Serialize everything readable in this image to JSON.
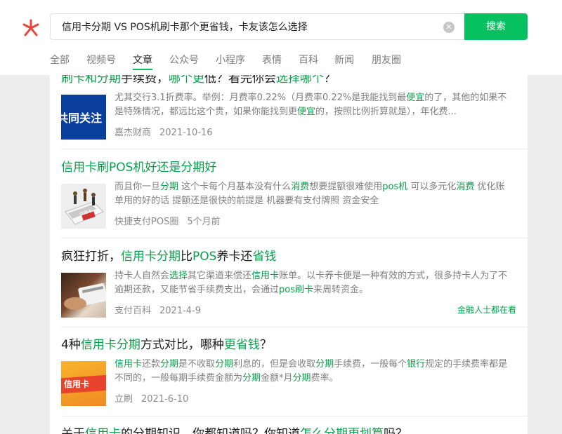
{
  "search": {
    "query": "信用卡分期 VS POS机刷卡那个更省钱，卡友该怎么选择",
    "button": "搜索"
  },
  "tabs": [
    "全部",
    "视频号",
    "文章",
    "公众号",
    "小程序",
    "表情",
    "百科",
    "新闻",
    "朋友圈"
  ],
  "active_tab": "文章",
  "results": [
    {
      "title": [
        {
          "t": "刷卡和分期",
          "h": true
        },
        {
          "t": "手续费，",
          "h": false
        },
        {
          "t": "哪个更",
          "h": true
        },
        {
          "t": "低？看完你会",
          "h": false
        },
        {
          "t": "选择哪个",
          "h": true
        },
        {
          "t": "？",
          "h": false
        }
      ],
      "thumb_text": "共同关注",
      "desc": [
        {
          "t": "尤其交行3.1折费率。举例：月费率0.22%（月费率0.22%是我能找到最",
          "h": false
        },
        {
          "t": "便宜",
          "h": true
        },
        {
          "t": "的了，其他的如果不是特殊情况，都远比这个贵，如果你能找到更",
          "h": false
        },
        {
          "t": "便宜",
          "h": true
        },
        {
          "t": "的，按照比例折算就是），年化费...",
          "h": false
        }
      ],
      "source": "嘉杰财商",
      "date": "2021-10-16"
    },
    {
      "title": [
        {
          "t": "信用卡刷POS机好还是分期好",
          "h": true
        }
      ],
      "thumb_text": "信用卡",
      "desc": [
        {
          "t": "而且你一旦",
          "h": false
        },
        {
          "t": "分期",
          "h": true
        },
        {
          "t": " 这个卡每个月基本没有什么",
          "h": false
        },
        {
          "t": "消费",
          "h": true
        },
        {
          "t": "想要提额很难使用",
          "h": false
        },
        {
          "t": "pos机",
          "h": true
        },
        {
          "t": " 可以多元化",
          "h": false
        },
        {
          "t": "消费",
          "h": true
        },
        {
          "t": " 优化账单用的好的话 提额还是很快的前提是 机器要有支付牌照 资金安全",
          "h": false
        }
      ],
      "source": "快捷支付POS圈",
      "date": "5个月前"
    },
    {
      "title": [
        {
          "t": "疯狂打折，",
          "h": false
        },
        {
          "t": "信用卡分期",
          "h": true
        },
        {
          "t": "比",
          "h": false
        },
        {
          "t": "POS",
          "h": true
        },
        {
          "t": "养卡还",
          "h": false
        },
        {
          "t": "省钱",
          "h": true
        }
      ],
      "desc": [
        {
          "t": "持卡人自然会",
          "h": false
        },
        {
          "t": "选择",
          "h": true
        },
        {
          "t": "其它渠道来偿还",
          "h": false
        },
        {
          "t": "信用卡",
          "h": true
        },
        {
          "t": "账单。以卡养卡便是一种有效的方式，很多持卡人为了不逾期还款，又能节省手续费支出，会通过",
          "h": false
        },
        {
          "t": "pos刷卡",
          "h": true
        },
        {
          "t": "来周转资金。",
          "h": false
        }
      ],
      "source": "支付百科",
      "date": "2021-4-9",
      "extra": "金融人士都在看"
    },
    {
      "title": [
        {
          "t": "4种",
          "h": false
        },
        {
          "t": "信用卡分期",
          "h": true
        },
        {
          "t": "方式对比，哪种",
          "h": false
        },
        {
          "t": "更省钱",
          "h": true
        },
        {
          "t": "？",
          "h": false
        }
      ],
      "thumb_text": "信用卡",
      "desc": [
        {
          "t": "信用卡",
          "h": true
        },
        {
          "t": "还款",
          "h": false
        },
        {
          "t": "分期",
          "h": true
        },
        {
          "t": "是不收取",
          "h": false
        },
        {
          "t": "分期",
          "h": true
        },
        {
          "t": "利息的，但是会收取",
          "h": false
        },
        {
          "t": "分期",
          "h": true
        },
        {
          "t": "手续费，一般每个",
          "h": false
        },
        {
          "t": "银行",
          "h": true
        },
        {
          "t": "规定的手续费率都是不同的，一般每期手续费金额为",
          "h": false
        },
        {
          "t": "分期",
          "h": true
        },
        {
          "t": "金额*月",
          "h": false
        },
        {
          "t": "分期",
          "h": true
        },
        {
          "t": "费率。",
          "h": false
        }
      ],
      "source": "立刷",
      "date": "2021-6-10"
    },
    {
      "title": [
        {
          "t": "关于",
          "h": false
        },
        {
          "t": "信用卡",
          "h": true
        },
        {
          "t": "的分期知识，你都知道吗？你知道",
          "h": false
        },
        {
          "t": "怎么分期更划算",
          "h": true
        },
        {
          "t": "吗？",
          "h": false
        }
      ]
    }
  ],
  "colors": {
    "accent": "#07c160",
    "highlight": "#07a04b",
    "background": "#ededed"
  },
  "icons": {
    "logo": "wechat-search-logo-icon",
    "clear": "clear-icon"
  }
}
